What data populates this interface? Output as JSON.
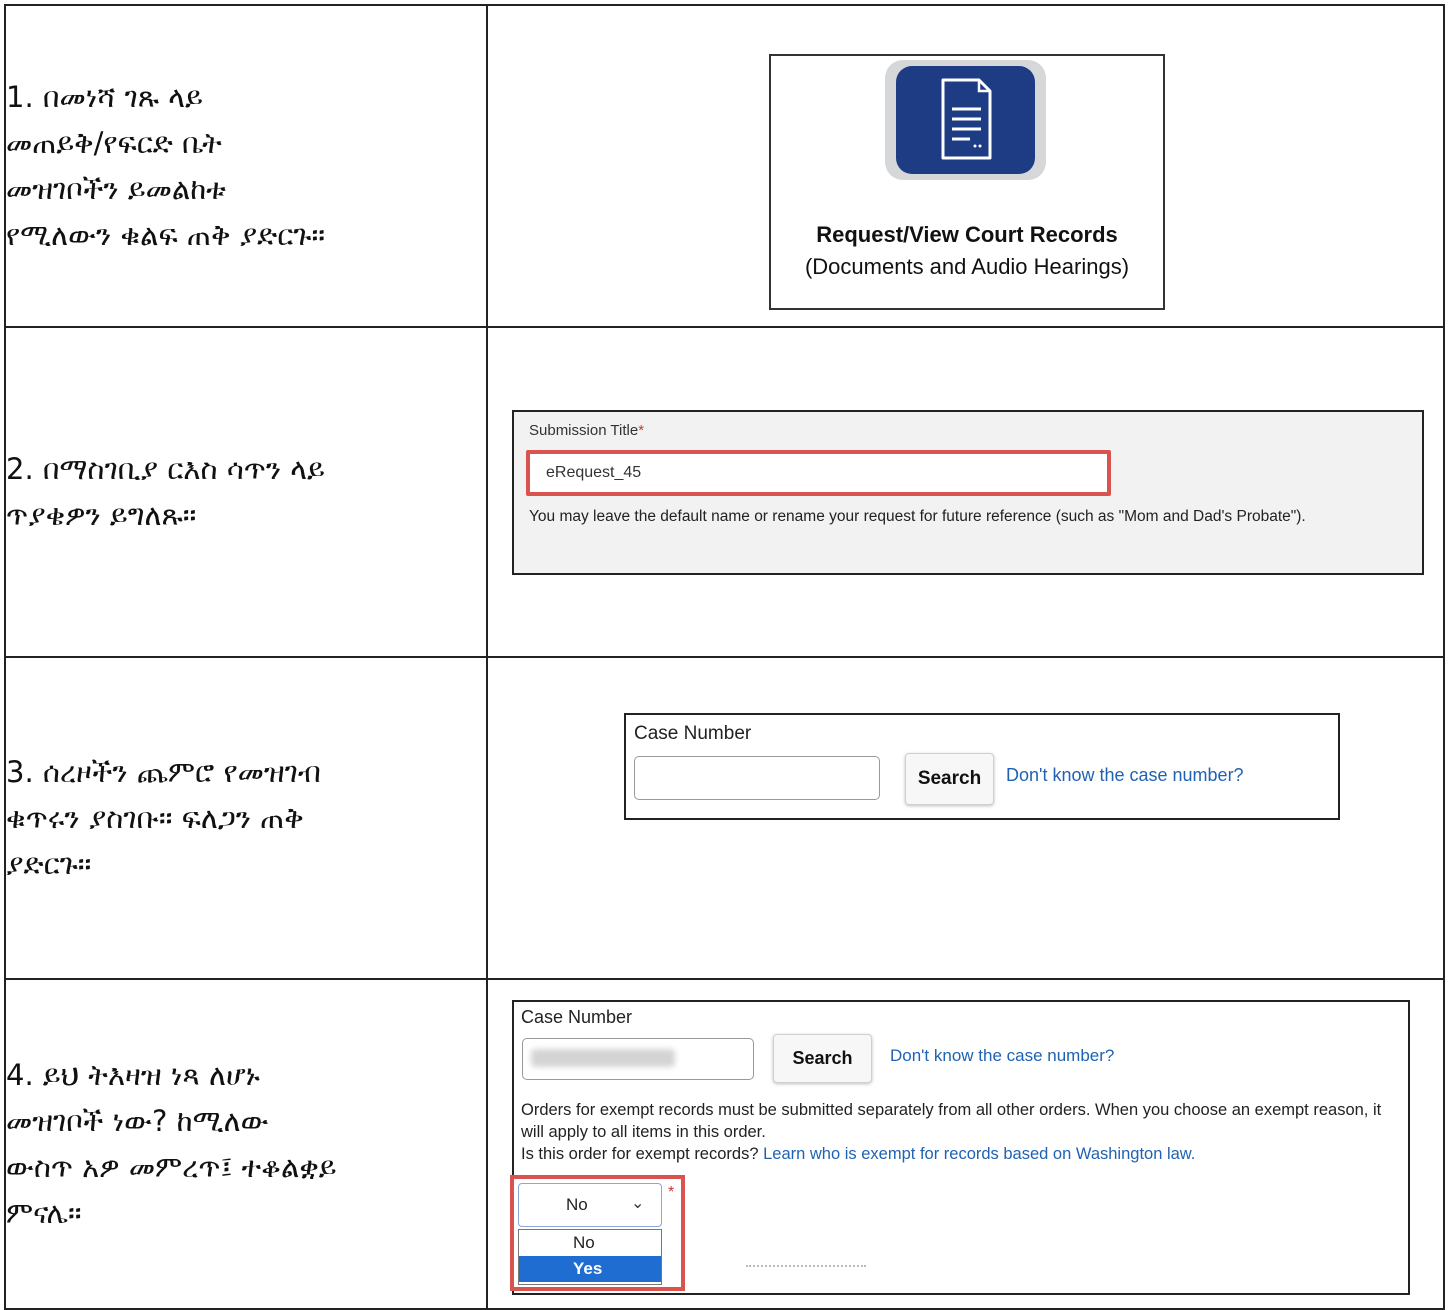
{
  "steps": [
    {
      "instruction_lines": [
        "1.  በመነሻ ገጹ ላይ",
        "መጠይቅ/የፍርድ ቤት",
        "መዝገቦችን ይመልከቱ",
        "የሚለውን ቁልፍ ጠቅ ያድርጉ።"
      ],
      "tile": {
        "title": "Request/View Court Records",
        "subtitle": "(Documents and Audio Hearings)",
        "icon": "document-icon",
        "icon_color": "#1e3c84"
      }
    },
    {
      "instruction_lines": [
        "2.  በማስገቢያ ርእስ ሳጥን ላይ",
        "ጥያቄዎን ይግለጹ።"
      ],
      "form": {
        "label": "Submission Title",
        "required_mark": "*",
        "value": "eRequest_45",
        "help": "You may leave the default name or rename your request for future reference (such as \"Mom and Dad's Probate\")."
      }
    },
    {
      "instruction_lines": [
        "3.  ሰረዞችን ጨምሮ የመዝገብ",
        "ቁጥሩን ያስገቡ። ፍለጋን ጠቅ",
        "ያድርጉ።"
      ],
      "form": {
        "label": "Case Number",
        "value": "",
        "button": "Search",
        "link": "Don't know the case number?"
      }
    },
    {
      "instruction_lines": [
        "4.  ይህ ትእዛዝ ነጻ ለሆኑ",
        "መዝገቦች ነው? ከሚለው",
        "ውስጥ አዎ መምረጥ፤ ተቆልቋይ",
        "ምናሌ።"
      ],
      "form": {
        "label": "Case Number",
        "button": "Search",
        "link": "Don't know the case number?",
        "note": "Orders for exempt records must be submitted separately from all other orders. When you choose an exempt reason, it will apply to all items in this order.",
        "question": "Is this order for exempt records?",
        "question_link": "Learn who is exempt for records based on Washington law.",
        "select_value": "No",
        "required_mark": "*",
        "options": [
          "No",
          "Yes"
        ],
        "highlighted_option": "Yes"
      }
    }
  ],
  "colors": {
    "highlight": "#d9534f",
    "link": "#1f62b4",
    "selected_option": "#1f6dd1",
    "required": "#d13438"
  }
}
